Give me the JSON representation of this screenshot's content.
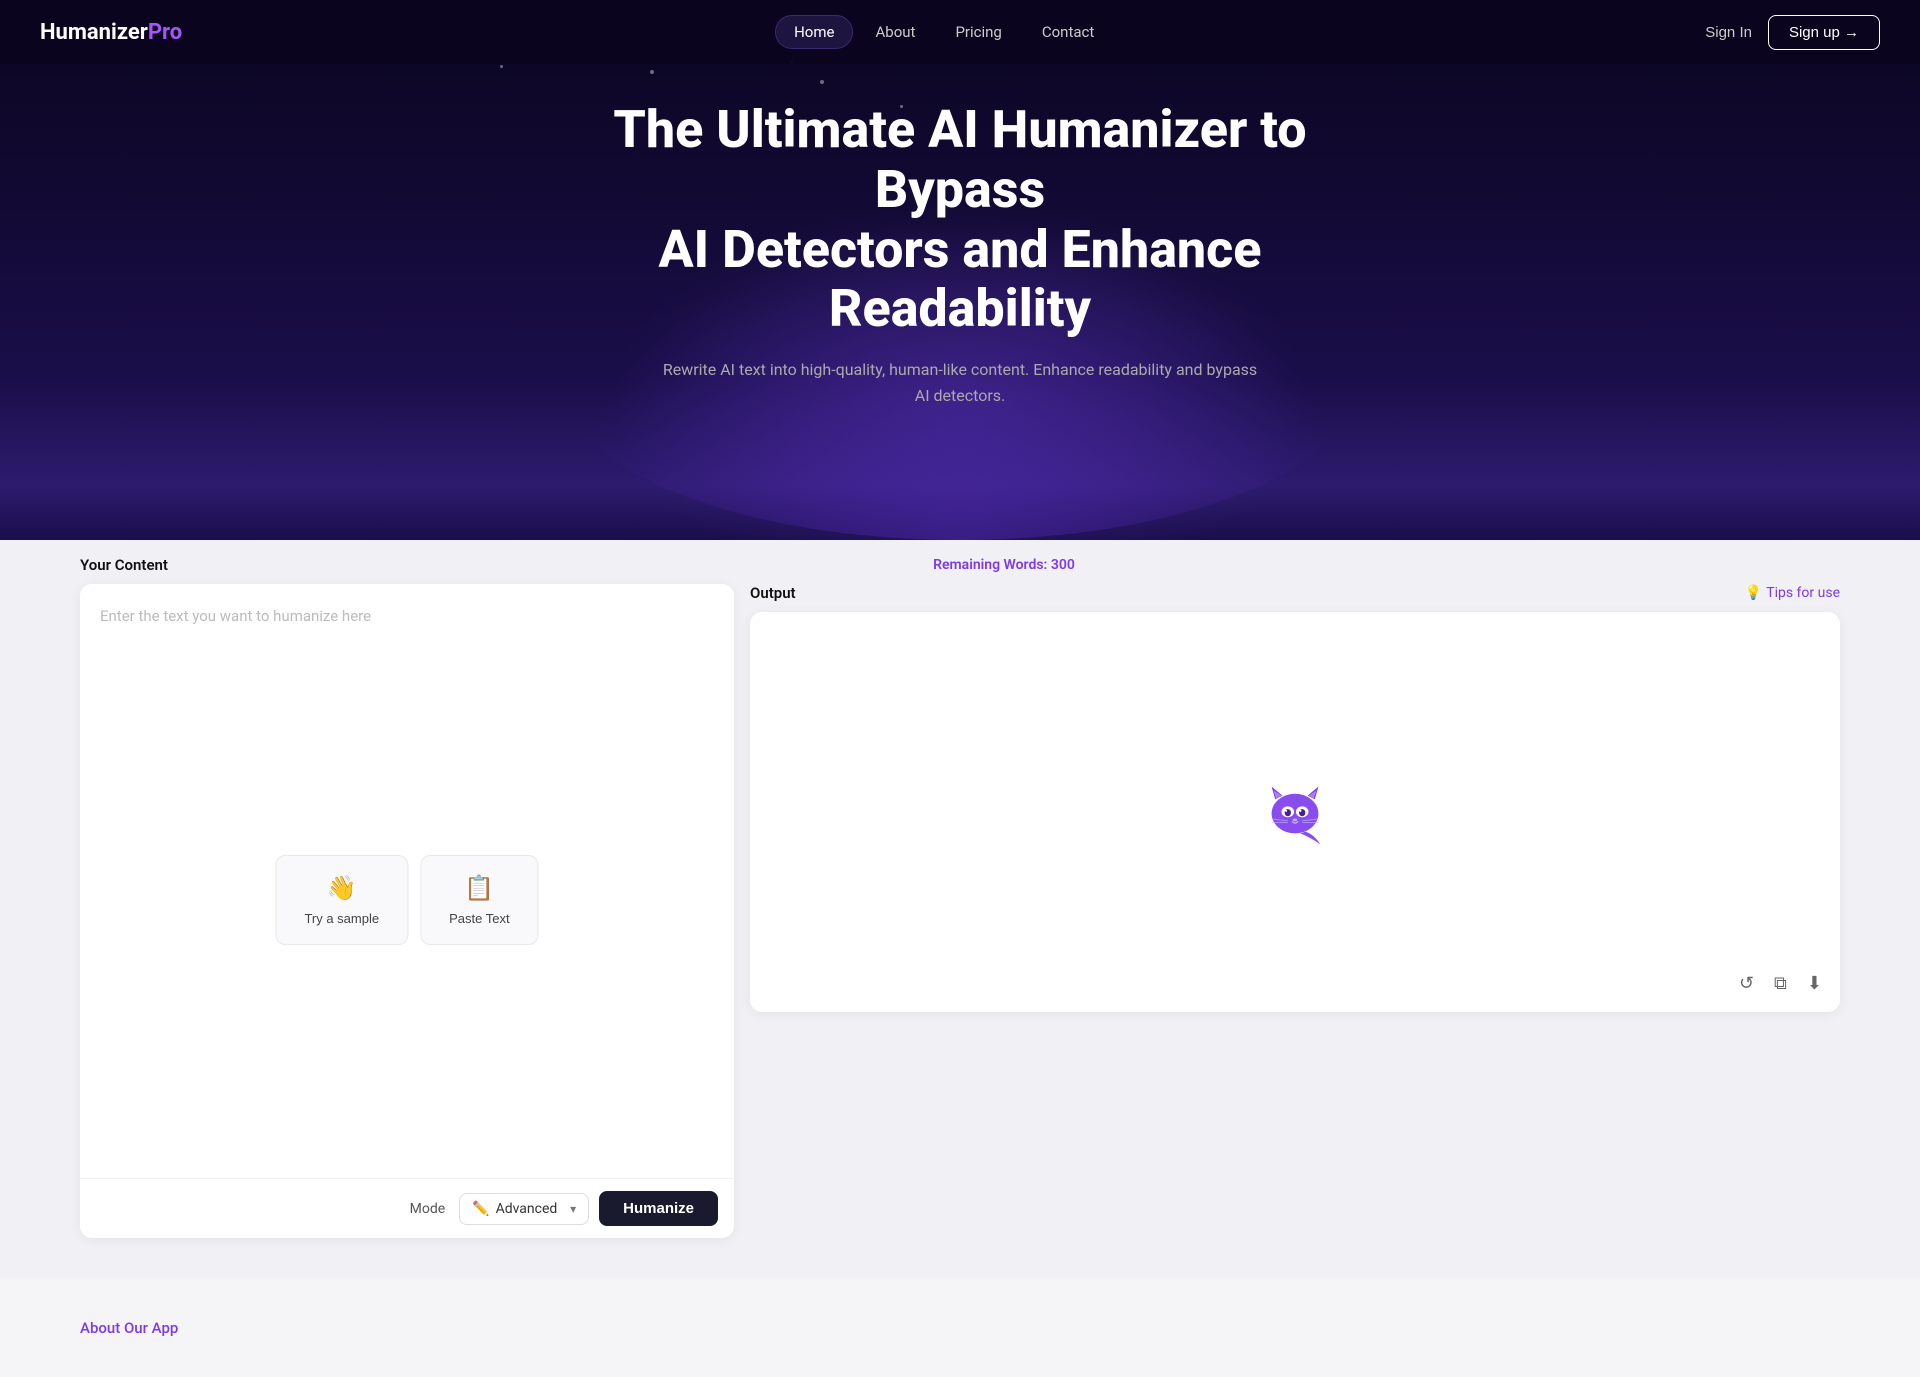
{
  "navbar": {
    "logo_humanizer": "Humanizer",
    "logo_pro": "Pro",
    "nav_links": [
      {
        "label": "Home",
        "active": true
      },
      {
        "label": "About",
        "active": false
      },
      {
        "label": "Pricing",
        "active": false
      },
      {
        "label": "Contact",
        "active": false
      }
    ],
    "sign_in_label": "Sign In",
    "sign_up_label": "Sign up →"
  },
  "hero": {
    "title_line1": "The Ultimate AI Humanizer to Bypass",
    "title_line2": "AI Detectors and Enhance Readability",
    "subtitle": "Rewrite AI text into high-quality, human-like content. Enhance readability and bypass AI detectors."
  },
  "editor": {
    "left_label": "Your Content",
    "remaining_label": "Remaining Words: 300",
    "right_label": "Output",
    "tips_label": "Tips for use",
    "input_placeholder": "Enter the text you want to humanize here",
    "sample_btn_label": "Try a sample",
    "paste_btn_label": "Paste Text",
    "mode_label": "Mode",
    "mode_value": "Advanced",
    "humanize_btn_label": "Humanize"
  },
  "bottom": {
    "about_label": "About Our App"
  },
  "icons": {
    "tips_icon": "💡",
    "sample_icon": "👋",
    "paste_icon": "📋",
    "mode_icon": "✏️",
    "refresh_icon": "↺",
    "copy_icon": "⧉",
    "download_icon": "⬇"
  }
}
